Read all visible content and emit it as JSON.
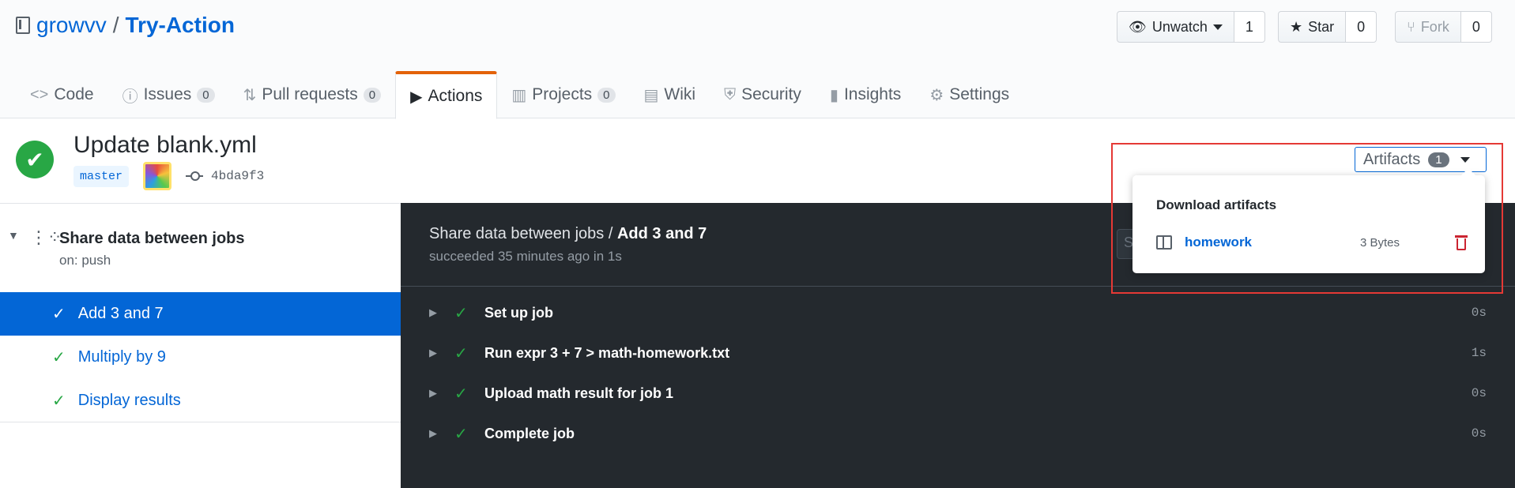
{
  "repo": {
    "owner": "growvv",
    "separator": "/",
    "name": "Try-Action"
  },
  "social": {
    "watch": {
      "label": "Unwatch",
      "count": "1"
    },
    "star": {
      "label": "Star",
      "count": "0"
    },
    "fork": {
      "label": "Fork",
      "count": "0"
    }
  },
  "tabs": [
    {
      "label": "Code",
      "icon": "code-icon"
    },
    {
      "label": "Issues",
      "count": "0",
      "icon": "issue-icon"
    },
    {
      "label": "Pull requests",
      "count": "0",
      "icon": "pull-request-icon"
    },
    {
      "label": "Actions",
      "icon": "play-icon",
      "active": true
    },
    {
      "label": "Projects",
      "count": "0",
      "icon": "project-icon"
    },
    {
      "label": "Wiki",
      "icon": "book-icon"
    },
    {
      "label": "Security",
      "icon": "shield-icon"
    },
    {
      "label": "Insights",
      "icon": "graph-icon"
    },
    {
      "label": "Settings",
      "icon": "gear-icon"
    }
  ],
  "run": {
    "title": "Update blank.yml",
    "branch": "master",
    "commit": "4bda9f3"
  },
  "workflow": {
    "name": "Share data between jobs",
    "trigger": "on: push",
    "jobs": [
      {
        "label": "Add 3 and 7",
        "active": true
      },
      {
        "label": "Multiply by 9"
      },
      {
        "label": "Display results"
      }
    ]
  },
  "logs": {
    "workflow": "Share data between jobs",
    "separator": " / ",
    "job": "Add 3 and 7",
    "status": "succeeded 35 minutes ago in 1s",
    "search_placeholder": "S",
    "steps": [
      {
        "name": "Set up job",
        "duration": "0s"
      },
      {
        "name": "Run expr 3 + 7 > math-homework.txt",
        "duration": "1s"
      },
      {
        "name": "Upload math result for job 1",
        "duration": "0s"
      },
      {
        "name": "Complete job",
        "duration": "0s"
      }
    ]
  },
  "artifacts": {
    "button_label": "Artifacts",
    "count": "1",
    "dropdown_title": "Download artifacts",
    "items": [
      {
        "name": "homework",
        "size": "3 Bytes"
      }
    ]
  },
  "colors": {
    "accent": "#0366d6",
    "success": "#28a745",
    "danger": "#cb2431",
    "tab_active": "#e36209",
    "highlight": "#e53935"
  }
}
